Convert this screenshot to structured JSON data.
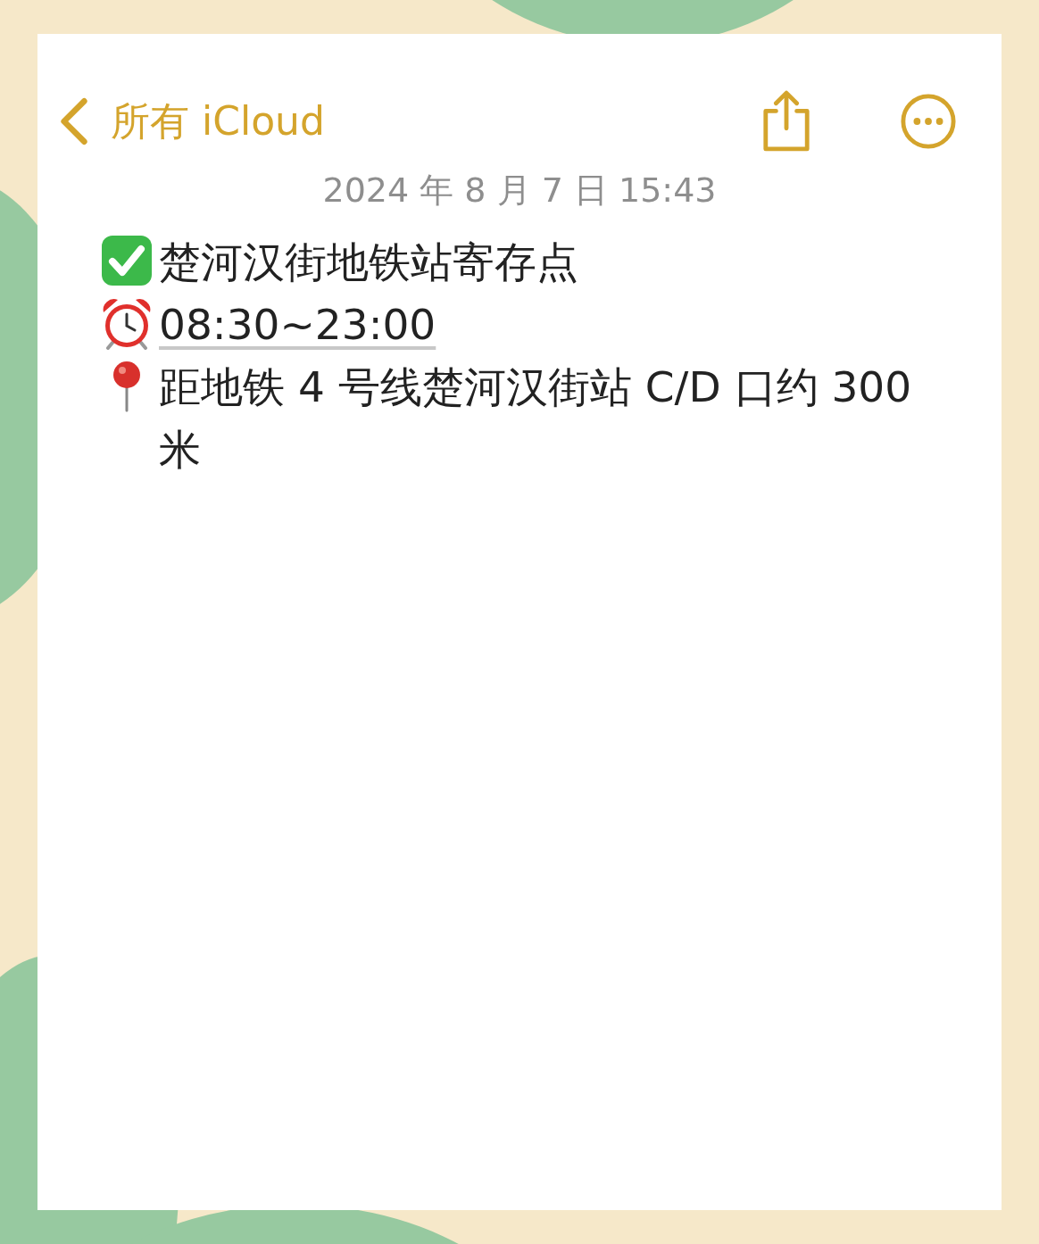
{
  "nav": {
    "back_label": "所有 iCloud"
  },
  "date": "2024 年 8 月 7 日 15:43",
  "lines": [
    {
      "kind": "check",
      "text": "楚河汉街地铁站寄存点",
      "link": false
    },
    {
      "kind": "alarm",
      "text": "08:30~23:00",
      "link": true
    },
    {
      "kind": "pin",
      "text": "距地铁 4 号线楚河汉街站 C/D 口约 300 米",
      "link": false
    }
  ]
}
